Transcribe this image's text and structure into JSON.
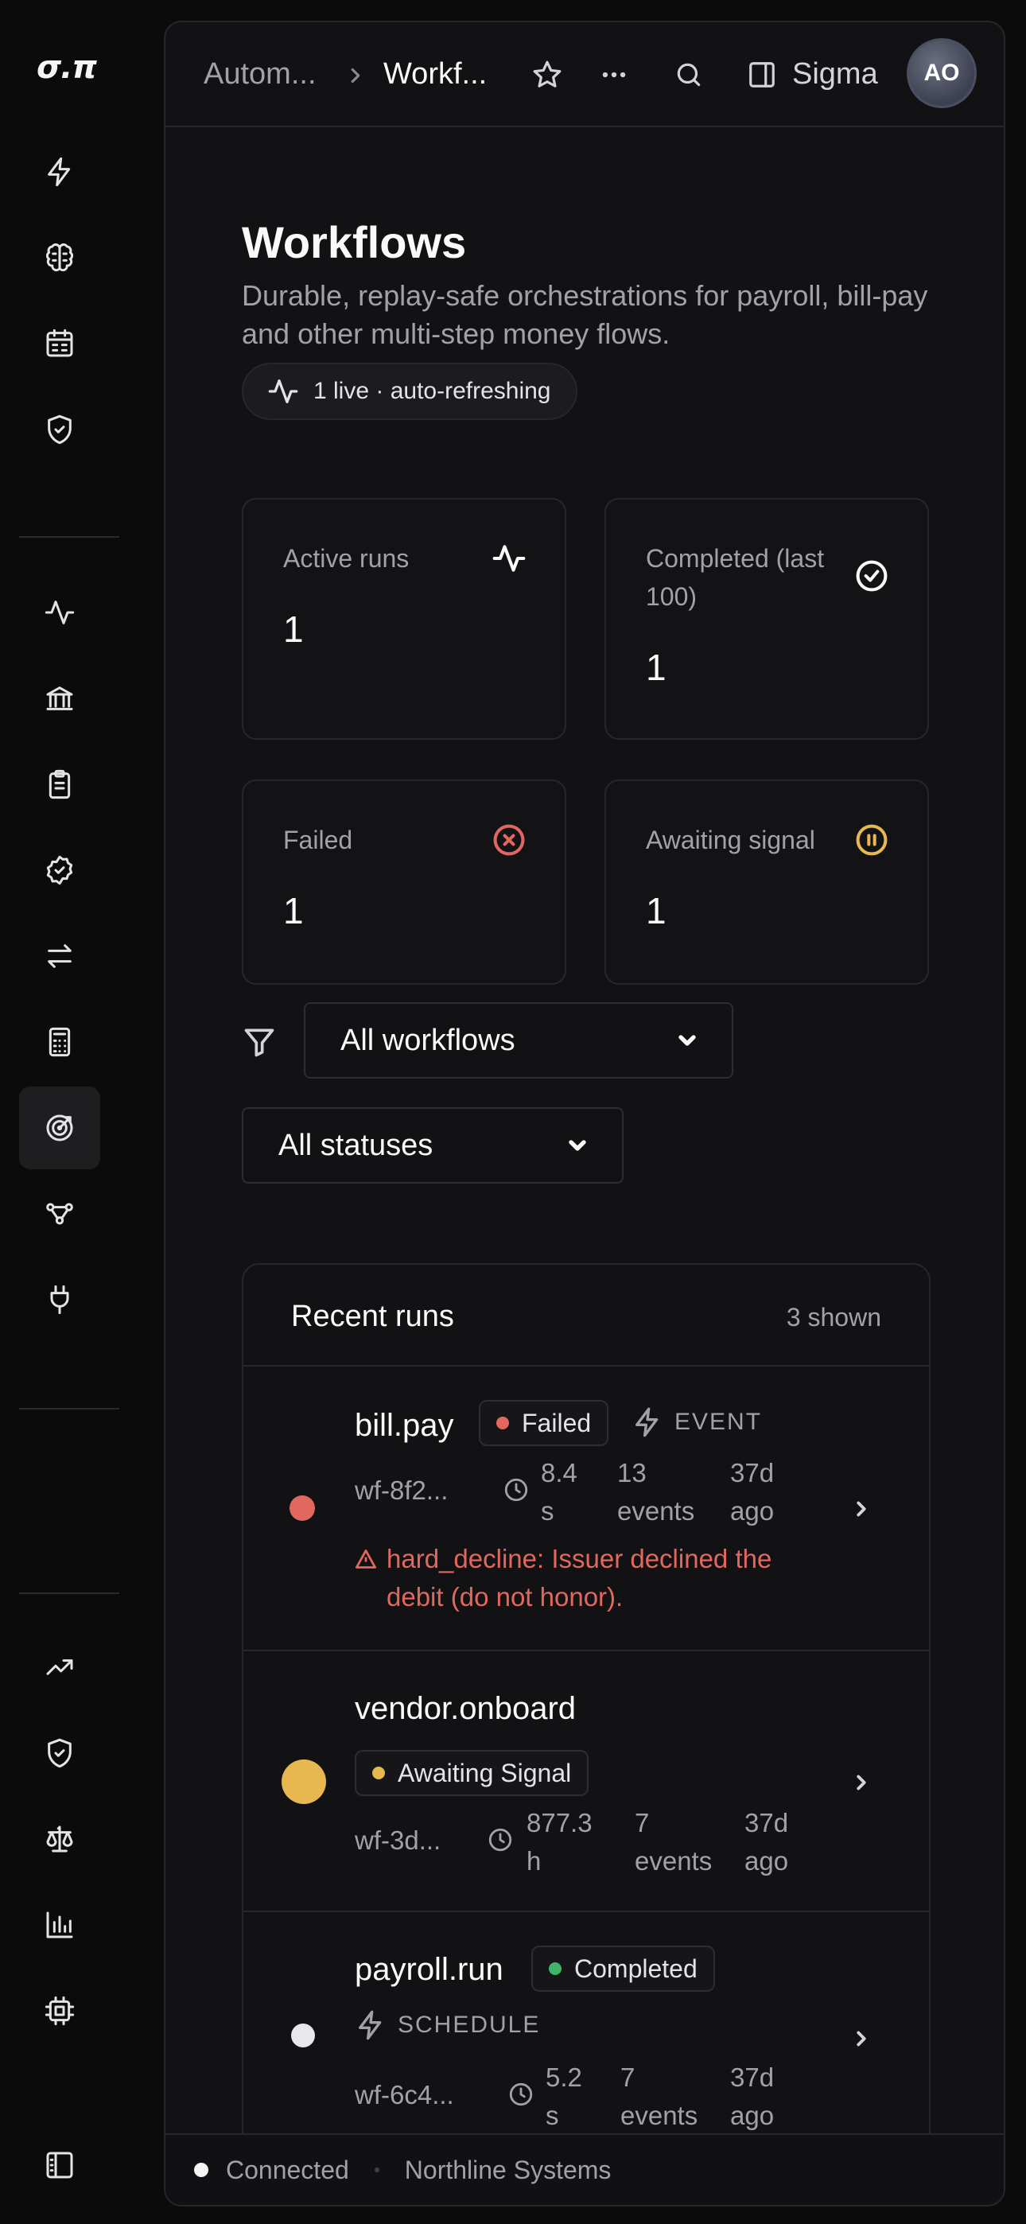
{
  "sidebar": {
    "logo": "σ.π",
    "icons": [
      "zap-icon",
      "brain-icon",
      "calendar-icon",
      "shield-check-icon",
      "activity-icon",
      "bank-icon",
      "clipboard-list-icon",
      "badge-check-icon",
      "arrows-left-right-icon",
      "calculator-icon",
      "target-radar-icon",
      "workflow-icon",
      "plug-icon",
      "trending-up-icon",
      "shield-check-2-icon",
      "scale-icon",
      "bar-chart-icon",
      "cpu-icon",
      "panel-left-icon"
    ],
    "active": "target-radar-icon"
  },
  "header": {
    "breadcrumb_parent": "Autom...",
    "breadcrumb_current": "Workf...",
    "panel_label": "Sigma",
    "avatar_initials": "AO"
  },
  "page": {
    "title": "Workflows",
    "description": "Durable, replay-safe orchestrations for payroll, bill-pay and other multi-step money flows.",
    "live_status": "1 live · auto-refreshing"
  },
  "stats": [
    {
      "label": "Active runs",
      "value": "1",
      "icon": "activity-icon"
    },
    {
      "label": "Completed (last 100)",
      "value": "1",
      "icon": "check-circle-icon"
    },
    {
      "label": "Failed",
      "value": "1",
      "icon": "x-circle-icon"
    },
    {
      "label": "Awaiting signal",
      "value": "1",
      "icon": "pause-circle-icon"
    }
  ],
  "filters": {
    "workflow_select": "All workflows",
    "status_select": "All statuses"
  },
  "runs": {
    "title": "Recent runs",
    "count": "3 shown",
    "items": [
      {
        "name": "bill.pay",
        "status": "Failed",
        "trigger": "EVENT",
        "id": "wf-8f2...",
        "duration": "8.4 s",
        "events": "13 events",
        "age": "37d ago",
        "error": "hard_decline: Issuer declined the debit (do not honor)."
      },
      {
        "name": "vendor.onboard",
        "status": "Awaiting Signal",
        "id": "wf-3d...",
        "duration": "877.3 h",
        "events": "7 events",
        "age": "37d ago"
      },
      {
        "name": "payroll.run",
        "status": "Completed",
        "trigger": "SCHEDULE",
        "id": "wf-6c4...",
        "duration": "5.2 s",
        "events": "7 events",
        "age": "37d ago"
      }
    ]
  },
  "footer": {
    "connection": "Connected",
    "org": "Northline Systems"
  },
  "colors": {
    "failed": "#e0685e",
    "awaiting": "#e6b84f",
    "completed": "#3fb56a",
    "idle_dot": "#e8e8ec"
  }
}
